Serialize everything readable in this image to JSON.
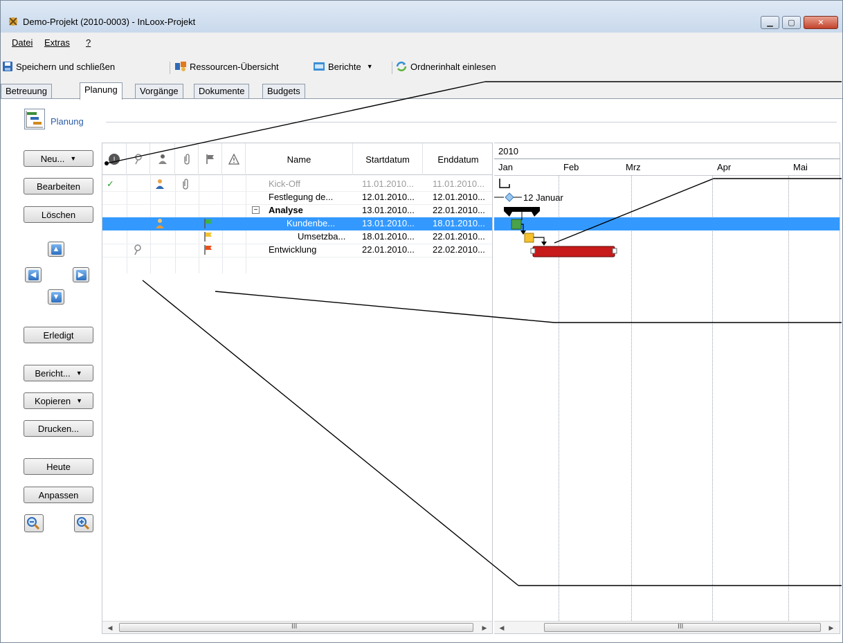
{
  "window": {
    "title": "Demo-Projekt (2010-0003) - InLoox-Projekt"
  },
  "menu": {
    "datei": "Datei",
    "extras": "Extras",
    "help": "?"
  },
  "toolbar": {
    "save_close": "Speichern und schließen",
    "resources": "Ressourcen-Übersicht",
    "reports": "Berichte",
    "read_folder": "Ordnerinhalt einlesen"
  },
  "tabs": [
    {
      "label": "Betreuung"
    },
    {
      "label": "Planung"
    },
    {
      "label": "Vorgänge"
    },
    {
      "label": "Dokumente"
    },
    {
      "label": "Budgets"
    }
  ],
  "section": {
    "label": "Planung"
  },
  "left_buttons": {
    "new": "Neu...",
    "edit": "Bearbeiten",
    "delete": "Löschen",
    "done": "Erledigt",
    "report": "Bericht...",
    "copy": "Kopieren",
    "print": "Drucken...",
    "today": "Heute",
    "fit": "Anpassen"
  },
  "grid": {
    "columns": {
      "name": "Name",
      "start": "Startdatum",
      "end": "Enddatum"
    },
    "rows": [
      {
        "name": "Kick-Off",
        "start": "11.01.2010...",
        "end": "11.01.2010..."
      },
      {
        "name": "Festlegung de...",
        "start": "12.01.2010...",
        "end": "12.01.2010..."
      },
      {
        "name": "Analyse",
        "start": "13.01.2010...",
        "end": "22.01.2010..."
      },
      {
        "name": "Kundenbe...",
        "start": "13.01.2010...",
        "end": "18.01.2010..."
      },
      {
        "name": "Umsetzba...",
        "start": "18.01.2010...",
        "end": "22.01.2010..."
      },
      {
        "name": "Entwicklung",
        "start": "22.01.2010...",
        "end": "22.02.2010..."
      }
    ]
  },
  "gantt": {
    "year": "2010",
    "months": [
      "Jan",
      "Feb",
      "Mrz",
      "Apr",
      "Mai"
    ],
    "milestone_label": "12 Januar"
  },
  "scroll": {
    "grip": "III"
  },
  "colors": {
    "selection": "#3399ff",
    "link": "#2d5ea8",
    "bar_green": "#4aa24a",
    "bar_yellow": "#f6c12c",
    "bar_red": "#c71a1a"
  }
}
